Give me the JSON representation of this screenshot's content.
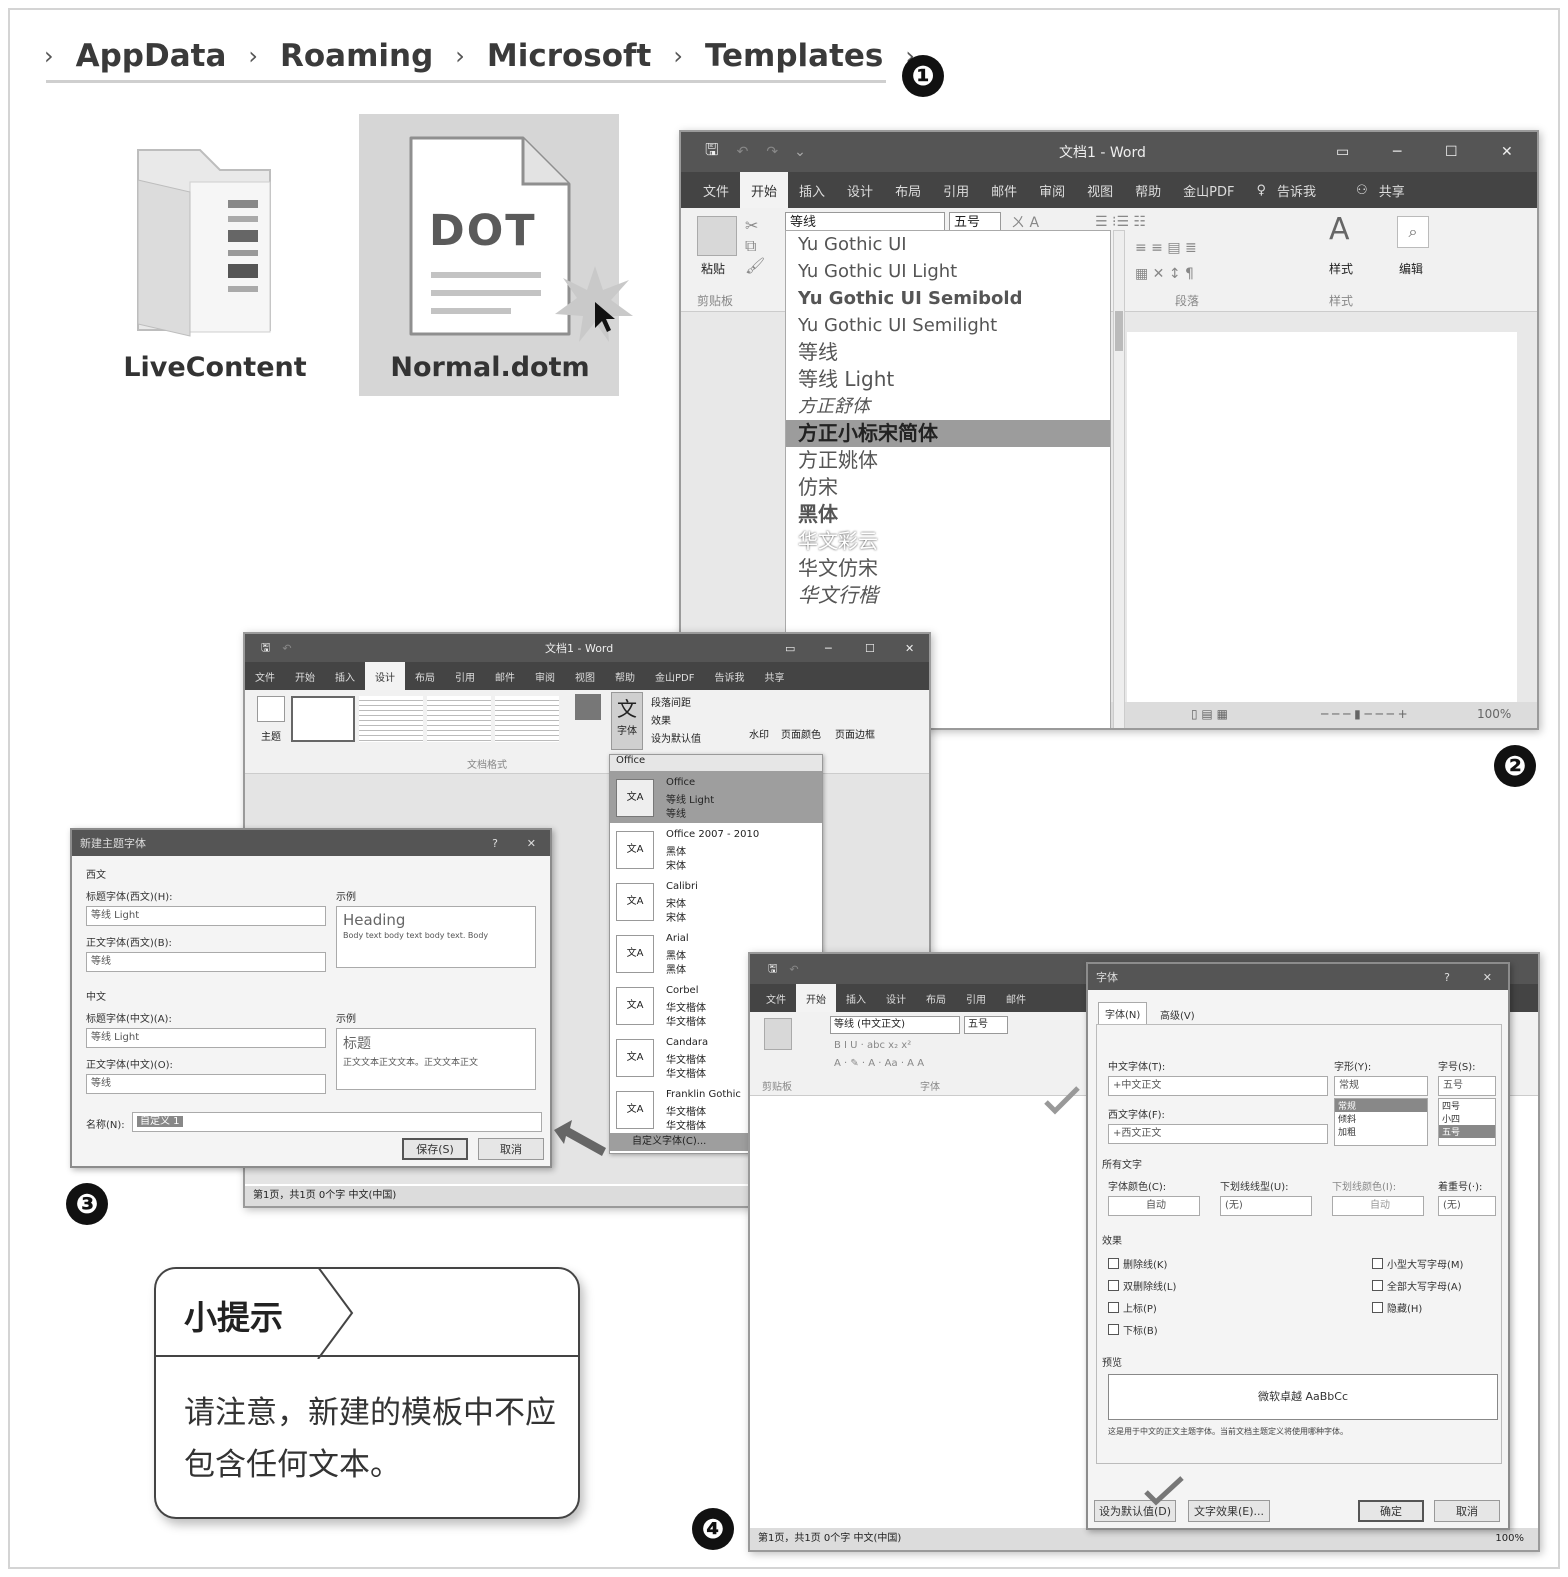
{
  "breadcrumb": [
    "AppData",
    "Roaming",
    "Microsoft",
    "Templates"
  ],
  "badges": [
    "❶",
    "❷",
    "❸",
    "❹"
  ],
  "files": [
    {
      "name": "LiveContent",
      "icon": "folder-icon"
    },
    {
      "name": "Normal.dotm",
      "icon": "dot-file-icon",
      "icon_text": "DOT"
    }
  ],
  "word_main": {
    "title": "文档1 - Word",
    "tabs": [
      "文件",
      "开始",
      "插入",
      "设计",
      "布局",
      "引用",
      "邮件",
      "审阅",
      "视图",
      "帮助",
      "金山PDF",
      "告诉我",
      "共享"
    ],
    "active_tab": "开始",
    "font_box": "等线",
    "size_box": "五号",
    "groups": [
      "剪贴板",
      "段落",
      "样式"
    ],
    "buttons": [
      "粘贴",
      "样式",
      "编辑"
    ],
    "zoom": "100%",
    "font_list": [
      "Yu Gothic UI",
      "Yu Gothic UI Light",
      "Yu Gothic UI Semibold",
      "Yu Gothic UI Semilight",
      "等线",
      "等线 Light",
      "方正舒体",
      "方正小标宋简体",
      "方正姚体",
      "仿宋",
      "黑体",
      "华文彩云",
      "华文仿宋",
      "华文行楷"
    ],
    "highlighted_font": "方正小标宋简体"
  },
  "word_design": {
    "title": "文档1 - Word",
    "tabs": [
      "文件",
      "开始",
      "插入",
      "设计",
      "布局",
      "引用",
      "邮件",
      "审阅",
      "视图",
      "帮助",
      "金山PDF",
      "告诉我",
      "共享"
    ],
    "active_tab": "设计",
    "group_label": "文档格式",
    "theme_buttons": [
      "主题",
      "字体"
    ],
    "menu_items": [
      "段落间距",
      "效果",
      "设为默认值"
    ],
    "page_buttons": [
      "水印",
      "页面颜色",
      "页面边框"
    ],
    "dropdown_header": "Office",
    "font_schemes": [
      {
        "name": "Office",
        "fonts": [
          "等线 Light",
          "等线"
        ]
      },
      {
        "name": "Office 2007 - 2010",
        "fonts": [
          "黑体",
          "宋体"
        ]
      },
      {
        "name": "Calibri",
        "fonts": [
          "宋体",
          "宋体"
        ]
      },
      {
        "name": "Arial",
        "fonts": [
          "黑体",
          "黑体"
        ]
      },
      {
        "name": "Corbel",
        "fonts": [
          "华文楷体",
          "华文楷体"
        ]
      },
      {
        "name": "Candara",
        "fonts": [
          "华文楷体",
          "华文楷体"
        ]
      },
      {
        "name": "Franklin Gothic",
        "fonts": [
          "华文楷体",
          "华文楷体"
        ]
      }
    ],
    "customize": "自定义字体(C)...",
    "status": "第1页，共1页   0个字   中文(中国)"
  },
  "theme_dialog": {
    "title": "新建主题字体",
    "section_latin": "西文",
    "heading_font_label": "标题字体(西文)(H):",
    "heading_font": "等线 Light",
    "body_font_label": "正文字体(西文)(B):",
    "body_font": "等线",
    "sample_label": "示例",
    "sample_heading": "Heading",
    "sample_body": "Body text body text body text. Body",
    "section_cjk": "中文",
    "heading_cjk_label": "标题字体(中文)(A):",
    "heading_cjk": "等线 Light",
    "body_cjk_label": "正文字体(中文)(O):",
    "body_cjk": "等线",
    "sample_cjk_heading": "标题",
    "sample_cjk_body": "正文文本正文文本。正文文本正文",
    "name_label": "名称(N):",
    "name_value": "自定义 1",
    "save": "保存(S)",
    "cancel": "取消"
  },
  "font_dialog": {
    "title": "字体",
    "tabs": [
      "字体(N)",
      "高级(V)"
    ],
    "cjk_font_label": "中文字体(T):",
    "cjk_font": "+中文正文",
    "latin_font_label": "西文字体(F):",
    "latin_font": "+西文正文",
    "style_label": "字形(Y):",
    "style_value": "常规",
    "style_options": [
      "常规",
      "倾斜",
      "加粗"
    ],
    "size_label": "字号(S):",
    "size_value": "五号",
    "size_options": [
      "四号",
      "小四",
      "五号"
    ],
    "all_text": "所有文字",
    "color_label": "字体颜色(C):",
    "color_value": "自动",
    "underline_label": "下划线线型(U):",
    "underline_value": "(无)",
    "underline_color_label": "下划线颜色(I):",
    "underline_color_value": "自动",
    "emphasis_label": "着重号(·):",
    "emphasis_value": "(无)",
    "effects": "效果",
    "effects_left": [
      "删除线(K)",
      "双删除线(L)",
      "上标(P)",
      "下标(B)"
    ],
    "effects_right": [
      "小型大写字母(M)",
      "全部大写字母(A)",
      "隐藏(H)"
    ],
    "preview": "预览",
    "preview_text": "微软卓越 AaBbCc",
    "preview_note": "这是用于中文的正文主题字体。当前文档主题定义将使用哪种字体。",
    "set_default": "设为默认值(D)",
    "text_effects": "文字效果(E)...",
    "ok": "确定",
    "cancel": "取消"
  },
  "word_back": {
    "tabs": [
      "文件",
      "开始",
      "插入",
      "设计",
      "布局",
      "引用",
      "邮件"
    ],
    "font_box": "等线 (中文正文)",
    "size_box": "五号",
    "groups": [
      "剪贴板",
      "字体"
    ],
    "status": "第1页，共1页   0个字   中文(中国)",
    "zoom": "100%"
  },
  "tip": {
    "title": "小提示",
    "text": "请注意，新建的模板中不应包含任何文本。"
  }
}
